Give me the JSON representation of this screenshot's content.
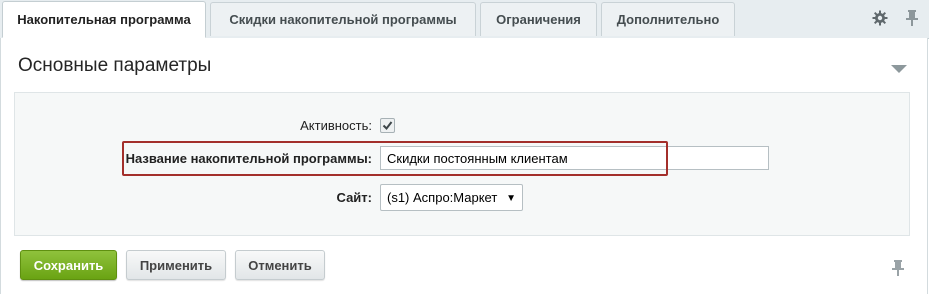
{
  "tabs": [
    {
      "label": "Накопительная программа",
      "active": true
    },
    {
      "label": "Скидки накопительной программы",
      "active": false
    },
    {
      "label": "Ограничения",
      "active": false
    },
    {
      "label": "Дополнительно",
      "active": false
    }
  ],
  "tab_icons": [
    "gear-icon",
    "pin-icon"
  ],
  "section": {
    "title": "Основные параметры"
  },
  "form": {
    "active_label": "Активность:",
    "active_checked": true,
    "name_label": "Название накопительной программы:",
    "name_value": "Скидки постоянным клиентам",
    "site_label": "Сайт:",
    "site_value": "(s1) Аспро:Маркет"
  },
  "buttons": {
    "save": "Сохранить",
    "apply": "Применить",
    "cancel": "Отменить"
  },
  "colors": {
    "save_button": "#6aa313",
    "highlight_border": "#a32f2b",
    "tab_bar": "#e7edf0"
  }
}
